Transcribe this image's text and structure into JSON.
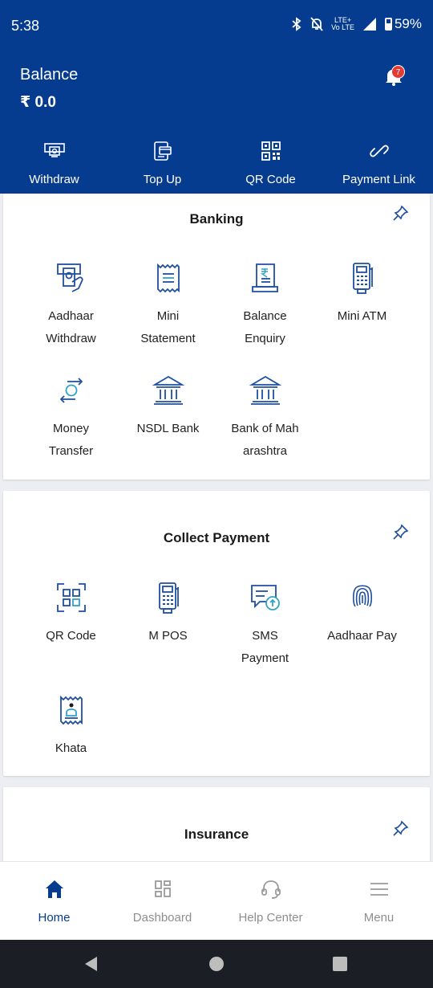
{
  "status_bar": {
    "time": "5:38",
    "network": "Vo LTE",
    "network_sub": "LTE+",
    "battery": "59%"
  },
  "header": {
    "balance_label": "Balance",
    "balance_value": "₹ 0.0",
    "notification_count": "7",
    "quick_actions": [
      {
        "label": "Withdraw",
        "icon": "withdraw-icon"
      },
      {
        "label": "Top Up",
        "icon": "top-up-icon"
      },
      {
        "label": "QR Code",
        "icon": "qr-code-icon"
      },
      {
        "label": "Payment Link",
        "icon": "link-icon"
      }
    ]
  },
  "banking": {
    "title": "Banking",
    "items": [
      {
        "line1": "Aadhaar",
        "line2": "Withdraw",
        "icon": "aadhaar-withdraw-icon"
      },
      {
        "line1": "Mini",
        "line2": "Statement",
        "icon": "receipt-icon"
      },
      {
        "line1": "Balance",
        "line2": "Enquiry",
        "icon": "balance-enquiry-icon"
      },
      {
        "line1": "Mini ATM",
        "line2": "",
        "icon": "pos-terminal-icon"
      },
      {
        "line1": "Money",
        "line2": "Transfer",
        "icon": "money-transfer-icon"
      },
      {
        "line1": "NSDL Bank",
        "line2": "",
        "icon": "bank-icon"
      },
      {
        "line1": "Bank of Mah",
        "line2": "arashtra",
        "icon": "bank-icon"
      }
    ]
  },
  "collect_payment": {
    "title": "Collect Payment",
    "items": [
      {
        "line1": "QR Code",
        "line2": "",
        "icon": "qr-scan-icon"
      },
      {
        "line1": "M POS",
        "line2": "",
        "icon": "pos-terminal-icon"
      },
      {
        "line1": "SMS",
        "line2": "Payment",
        "icon": "sms-payment-icon"
      },
      {
        "line1": "Aadhaar Pay",
        "line2": "",
        "icon": "fingerprint-icon"
      },
      {
        "line1": "Khata",
        "line2": "",
        "icon": "khata-icon"
      }
    ]
  },
  "insurance": {
    "title": "Insurance"
  },
  "bottom_nav": [
    {
      "label": "Home",
      "icon": "home-icon",
      "active": true
    },
    {
      "label": "Dashboard",
      "icon": "dashboard-icon",
      "active": false
    },
    {
      "label": "Help Center",
      "icon": "headset-icon",
      "active": false
    },
    {
      "label": "Menu",
      "icon": "menu-icon",
      "active": false
    }
  ],
  "colors": {
    "primary": "#063c8f",
    "icon_blue": "#1f4fa0",
    "badge": "#e53935",
    "inactive": "#8e8e8e",
    "background": "#eceef2"
  }
}
